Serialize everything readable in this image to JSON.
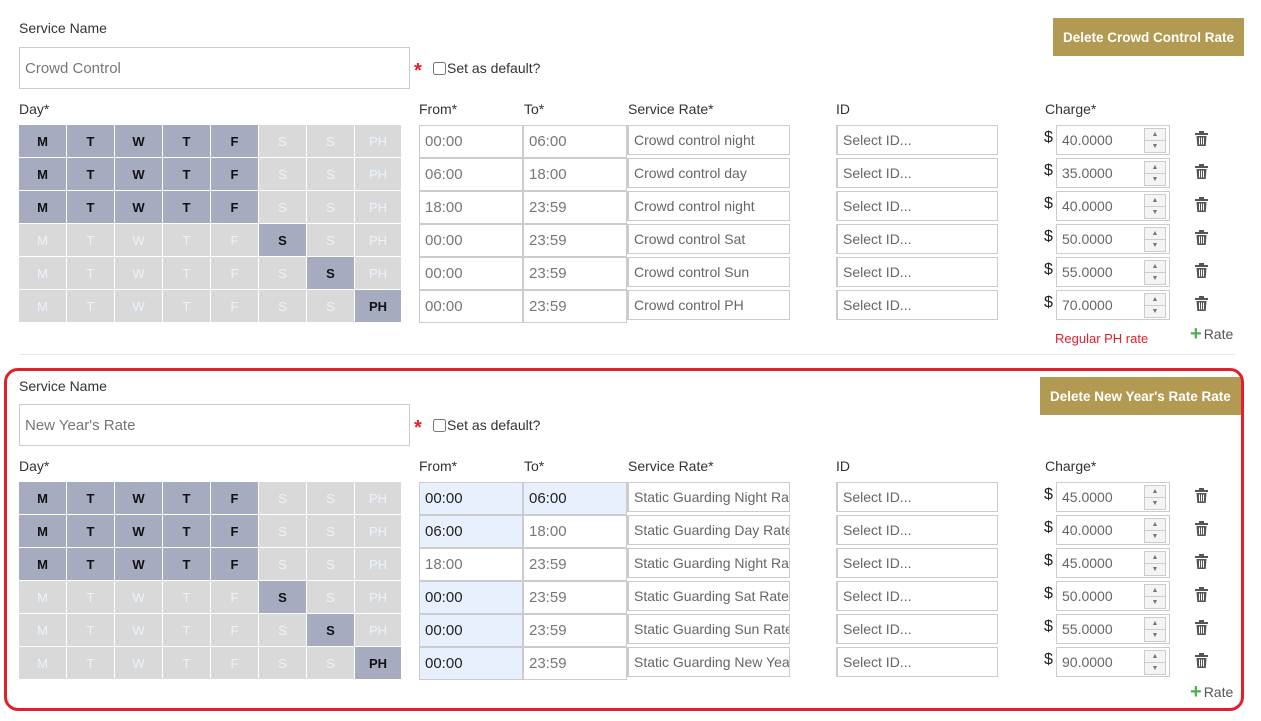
{
  "labels": {
    "service_name": "Service Name",
    "set_default": "Set as default?",
    "required": "*",
    "day": "Day*",
    "from": "From*",
    "to": "To*",
    "service_rate": "Service Rate*",
    "id": "ID",
    "charge": "Charge*",
    "add_rate": "Rate",
    "currency": "$"
  },
  "services": [
    {
      "name": "Crowd Control",
      "delete_label": "Delete Crowd Control Rate",
      "note": "Regular PH rate",
      "rows": [
        {
          "days": [
            "M",
            "T",
            "W",
            "T",
            "F",
            "S",
            "S",
            "PH"
          ],
          "active": [
            1,
            1,
            1,
            1,
            1,
            0,
            0,
            0
          ],
          "from": "00:00",
          "to": "06:00",
          "rate": "Crowd control night",
          "id_placeholder": "Select ID...",
          "charge": "40.0000"
        },
        {
          "days": [
            "M",
            "T",
            "W",
            "T",
            "F",
            "S",
            "S",
            "PH"
          ],
          "active": [
            1,
            1,
            1,
            1,
            1,
            0,
            0,
            0
          ],
          "from": "06:00",
          "to": "18:00",
          "rate": "Crowd control day",
          "id_placeholder": "Select ID...",
          "charge": "35.0000"
        },
        {
          "days": [
            "M",
            "T",
            "W",
            "T",
            "F",
            "S",
            "S",
            "PH"
          ],
          "active": [
            1,
            1,
            1,
            1,
            1,
            0,
            0,
            0
          ],
          "from": "18:00",
          "to": "23:59",
          "rate": "Crowd control night",
          "id_placeholder": "Select ID...",
          "charge": "40.0000"
        },
        {
          "days": [
            "M",
            "T",
            "W",
            "T",
            "F",
            "S",
            "S",
            "PH"
          ],
          "active": [
            0,
            0,
            0,
            0,
            0,
            1,
            0,
            0
          ],
          "from": "00:00",
          "to": "23:59",
          "rate": "Crowd control Sat",
          "id_placeholder": "Select ID...",
          "charge": "50.0000"
        },
        {
          "days": [
            "M",
            "T",
            "W",
            "T",
            "F",
            "S",
            "S",
            "PH"
          ],
          "active": [
            0,
            0,
            0,
            0,
            0,
            0,
            1,
            0
          ],
          "from": "00:00",
          "to": "23:59",
          "rate": "Crowd control Sun",
          "id_placeholder": "Select ID...",
          "charge": "55.0000"
        },
        {
          "days": [
            "M",
            "T",
            "W",
            "T",
            "F",
            "S",
            "S",
            "PH"
          ],
          "active": [
            0,
            0,
            0,
            0,
            0,
            0,
            0,
            1
          ],
          "from": "00:00",
          "to": "23:59",
          "rate": "Crowd control PH",
          "id_placeholder": "Select ID...",
          "charge": "70.0000"
        }
      ]
    },
    {
      "name": "New Year's Rate",
      "delete_label": "Delete New Year's Rate Rate",
      "note": "",
      "rows": [
        {
          "days": [
            "M",
            "T",
            "W",
            "T",
            "F",
            "S",
            "S",
            "PH"
          ],
          "active": [
            1,
            1,
            1,
            1,
            1,
            0,
            0,
            0
          ],
          "from": "00:00",
          "to": "06:00",
          "rate": "Static Guarding Night Rate",
          "id_placeholder": "Select ID...",
          "charge": "45.0000"
        },
        {
          "days": [
            "M",
            "T",
            "W",
            "T",
            "F",
            "S",
            "S",
            "PH"
          ],
          "active": [
            1,
            1,
            1,
            1,
            1,
            0,
            0,
            0
          ],
          "from": "06:00",
          "to": "18:00",
          "rate": "Static Guarding Day Rate",
          "id_placeholder": "Select ID...",
          "charge": "40.0000"
        },
        {
          "days": [
            "M",
            "T",
            "W",
            "T",
            "F",
            "S",
            "S",
            "PH"
          ],
          "active": [
            1,
            1,
            1,
            1,
            1,
            0,
            0,
            0
          ],
          "from": "18:00",
          "to": "23:59",
          "rate": "Static Guarding Night Rate",
          "id_placeholder": "Select ID...",
          "charge": "45.0000"
        },
        {
          "days": [
            "M",
            "T",
            "W",
            "T",
            "F",
            "S",
            "S",
            "PH"
          ],
          "active": [
            0,
            0,
            0,
            0,
            0,
            1,
            0,
            0
          ],
          "from": "00:00",
          "to": "23:59",
          "rate": "Static Guarding Sat Rate",
          "id_placeholder": "Select ID...",
          "charge": "50.0000"
        },
        {
          "days": [
            "M",
            "T",
            "W",
            "T",
            "F",
            "S",
            "S",
            "PH"
          ],
          "active": [
            0,
            0,
            0,
            0,
            0,
            0,
            1,
            0
          ],
          "from": "00:00",
          "to": "23:59",
          "rate": "Static Guarding Sun Rate",
          "id_placeholder": "Select ID...",
          "charge": "55.0000"
        },
        {
          "days": [
            "M",
            "T",
            "W",
            "T",
            "F",
            "S",
            "S",
            "PH"
          ],
          "active": [
            0,
            0,
            0,
            0,
            0,
            0,
            0,
            1
          ],
          "from": "00:00",
          "to": "23:59",
          "rate": "Static Guarding New Year Rate",
          "id_placeholder": "Select ID...",
          "charge": "90.0000"
        }
      ],
      "active_from": [
        1,
        1,
        0,
        1,
        1,
        1
      ],
      "active_to": [
        1,
        0,
        0,
        0,
        0,
        0
      ]
    }
  ],
  "colors": {
    "accent_button": "#b39a52",
    "required": "#e41f2d",
    "highlight_border": "#e41f2d",
    "day_active": "#a7abc0",
    "day_inactive": "#d9d9d9",
    "add_icon": "#4caf50"
  }
}
